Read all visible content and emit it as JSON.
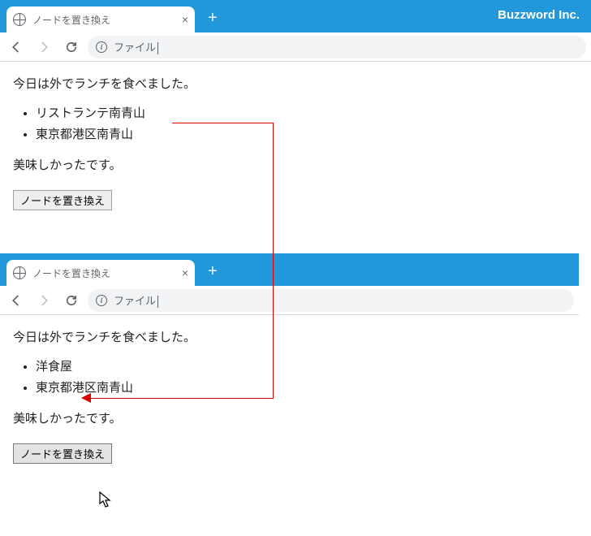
{
  "brand": "Buzzword Inc.",
  "window1": {
    "tab_title": "ノードを置き換え",
    "addr": "ファイル",
    "para1": "今日は外でランチを食べました。",
    "list": [
      "リストランテ南青山",
      "東京都港区南青山"
    ],
    "para2": "美味しかったです。",
    "button": "ノードを置き換え"
  },
  "window2": {
    "tab_title": "ノードを置き換え",
    "addr": "ファイル",
    "para1": "今日は外でランチを食べました。",
    "list": [
      "洋食屋",
      "東京都港区南青山"
    ],
    "para2": "美味しかったです。",
    "button": "ノードを置き換え"
  }
}
